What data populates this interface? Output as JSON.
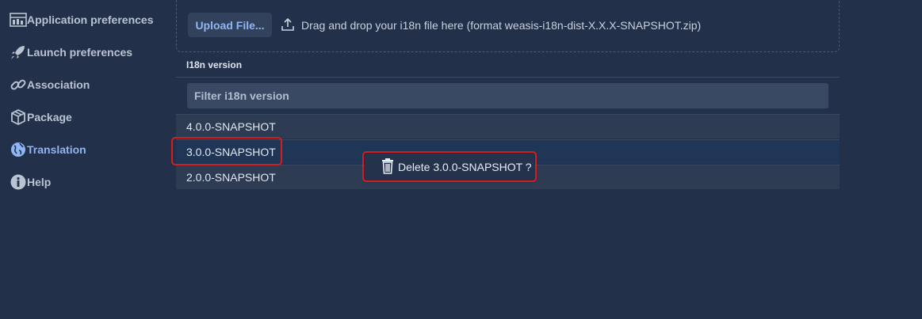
{
  "sidebar": {
    "items": [
      {
        "label": "Application preferences",
        "icon": "preferences-icon"
      },
      {
        "label": "Launch preferences",
        "icon": "rocket-icon"
      },
      {
        "label": "Association",
        "icon": "link-icon"
      },
      {
        "label": "Package",
        "icon": "package-icon"
      },
      {
        "label": "Translation",
        "icon": "globe-icon"
      },
      {
        "label": "Help",
        "icon": "info-icon"
      }
    ],
    "active": "Translation"
  },
  "upload": {
    "button_label": "Upload File...",
    "hint": "Drag and drop your i18n file here (format weasis-i18n-dist-X.X.X-SNAPSHOT.zip)"
  },
  "table": {
    "header": "I18n version",
    "filter_placeholder": "Filter i18n version",
    "rows": [
      "4.0.0-SNAPSHOT",
      "3.0.0-SNAPSHOT",
      "2.0.0-SNAPSHOT"
    ],
    "selected_row": "3.0.0-SNAPSHOT"
  },
  "context_menu": {
    "delete_label": "Delete 3.0.0-SNAPSHOT ?",
    "icon": "trash-icon"
  },
  "colors": {
    "background": "#22304a",
    "accent": "#8fb6f2",
    "highlight": "#d11f1f"
  }
}
